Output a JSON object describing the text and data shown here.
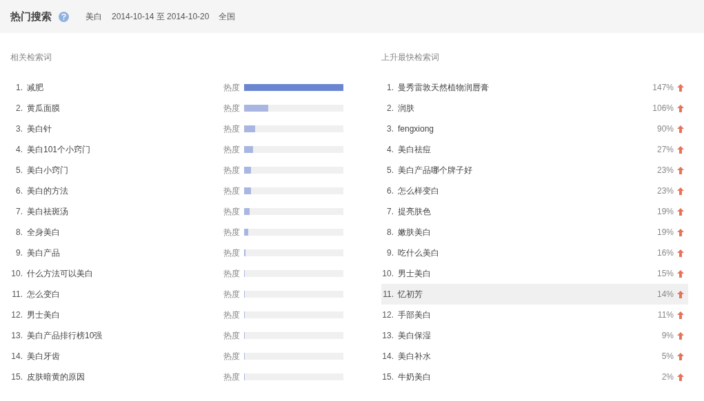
{
  "header": {
    "title": "热门搜索",
    "keyword": "美白",
    "date_range": "2014-10-14 至 2014-10-20",
    "region": "全国"
  },
  "related": {
    "heading": "相关检索词",
    "rows": [
      {
        "rank": "1.",
        "term": "减肥",
        "label": "热度",
        "level": 1,
        "highlighted": true
      },
      {
        "rank": "2.",
        "term": "黄瓜面膜",
        "label": "热度",
        "level": 0.24,
        "highlighted": false
      },
      {
        "rank": "3.",
        "term": "美白针",
        "label": "热度",
        "level": 0.11,
        "highlighted": false
      },
      {
        "rank": "4.",
        "term": "美白101个小窍门",
        "label": "热度",
        "level": 0.09,
        "highlighted": false
      },
      {
        "rank": "5.",
        "term": "美白小窍门",
        "label": "热度",
        "level": 0.07,
        "highlighted": false
      },
      {
        "rank": "6.",
        "term": "美白的方法",
        "label": "热度",
        "level": 0.07,
        "highlighted": false
      },
      {
        "rank": "7.",
        "term": "美白祛斑汤",
        "label": "热度",
        "level": 0.055,
        "highlighted": false
      },
      {
        "rank": "8.",
        "term": "全身美白",
        "label": "热度",
        "level": 0.045,
        "highlighted": false
      },
      {
        "rank": "9.",
        "term": "美白产品",
        "label": "热度",
        "level": 0.012,
        "highlighted": false
      },
      {
        "rank": "10.",
        "term": "什么方法可以美白",
        "label": "热度",
        "level": 0.006,
        "highlighted": false
      },
      {
        "rank": "11.",
        "term": "怎么变白",
        "label": "热度",
        "level": 0.006,
        "highlighted": false
      },
      {
        "rank": "12.",
        "term": "男士美白",
        "label": "热度",
        "level": 0.006,
        "highlighted": false
      },
      {
        "rank": "13.",
        "term": "美白产品排行榜10强",
        "label": "热度",
        "level": 0.006,
        "highlighted": false
      },
      {
        "rank": "14.",
        "term": "美白牙齿",
        "label": "热度",
        "level": 0.006,
        "highlighted": false
      },
      {
        "rank": "15.",
        "term": "皮肤暗黄的原因",
        "label": "热度",
        "level": 0.006,
        "highlighted": false
      }
    ]
  },
  "rising": {
    "heading": "上升最快检索词",
    "rows": [
      {
        "rank": "1.",
        "term": "曼秀雷敦天然植物润唇膏",
        "change": "147%",
        "highlighted": false
      },
      {
        "rank": "2.",
        "term": "润肤",
        "change": "106%",
        "highlighted": false
      },
      {
        "rank": "3.",
        "term": "fengxiong",
        "change": "90%",
        "highlighted": false
      },
      {
        "rank": "4.",
        "term": "美白祛痘",
        "change": "27%",
        "highlighted": false
      },
      {
        "rank": "5.",
        "term": "美白产品哪个牌子好",
        "change": "23%",
        "highlighted": false
      },
      {
        "rank": "6.",
        "term": "怎么样变白",
        "change": "23%",
        "highlighted": false
      },
      {
        "rank": "7.",
        "term": "提亮肤色",
        "change": "19%",
        "highlighted": false
      },
      {
        "rank": "8.",
        "term": "嫩肤美白",
        "change": "19%",
        "highlighted": false
      },
      {
        "rank": "9.",
        "term": "吃什么美白",
        "change": "16%",
        "highlighted": false
      },
      {
        "rank": "10.",
        "term": "男士美白",
        "change": "15%",
        "highlighted": false
      },
      {
        "rank": "11.",
        "term": "忆初芳",
        "change": "14%",
        "highlighted": true
      },
      {
        "rank": "12.",
        "term": "手部美白",
        "change": "11%",
        "highlighted": false
      },
      {
        "rank": "13.",
        "term": "美白保湿",
        "change": "9%",
        "highlighted": false
      },
      {
        "rank": "14.",
        "term": "美白补水",
        "change": "5%",
        "highlighted": false
      },
      {
        "rank": "15.",
        "term": "牛奶美白",
        "change": "2%",
        "highlighted": false
      }
    ]
  }
}
